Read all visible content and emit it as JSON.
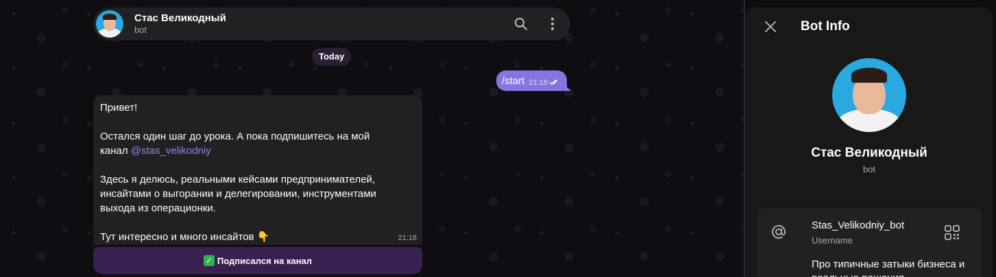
{
  "chat": {
    "header": {
      "name": "Стас Великодный",
      "status": "bot"
    },
    "date_label": "Today",
    "outgoing": {
      "text": "/start",
      "time": "21:18"
    },
    "incoming": {
      "line1": "Привет!",
      "line2_prefix": "Остался один шаг до урока. А пока подпишитесь на мой\nканал ",
      "mention": "@stas_velikodniy",
      "paragraph2": "Здесь я делюсь, реальными кейсами предпринимателей,\nинсайтами о выгорании и делегировании, инструментами\nвыхода из операционки.",
      "paragraph3": "Тут интересно и много инсайтов 👇",
      "time": "21:18"
    },
    "inline_button": {
      "label": "Подписался на канал"
    }
  },
  "bot_info": {
    "title": "Bot Info",
    "name": "Стас Великодный",
    "status": "bot",
    "username": "Stas_Velikodniy_bot",
    "username_label": "Username",
    "bio": "Про типичные затыки бизнеса и реальные решения"
  },
  "colors": {
    "accent": "#8774e1",
    "panel": "#181818",
    "bubble_in": "#212121",
    "mention": "#8f89e8"
  }
}
